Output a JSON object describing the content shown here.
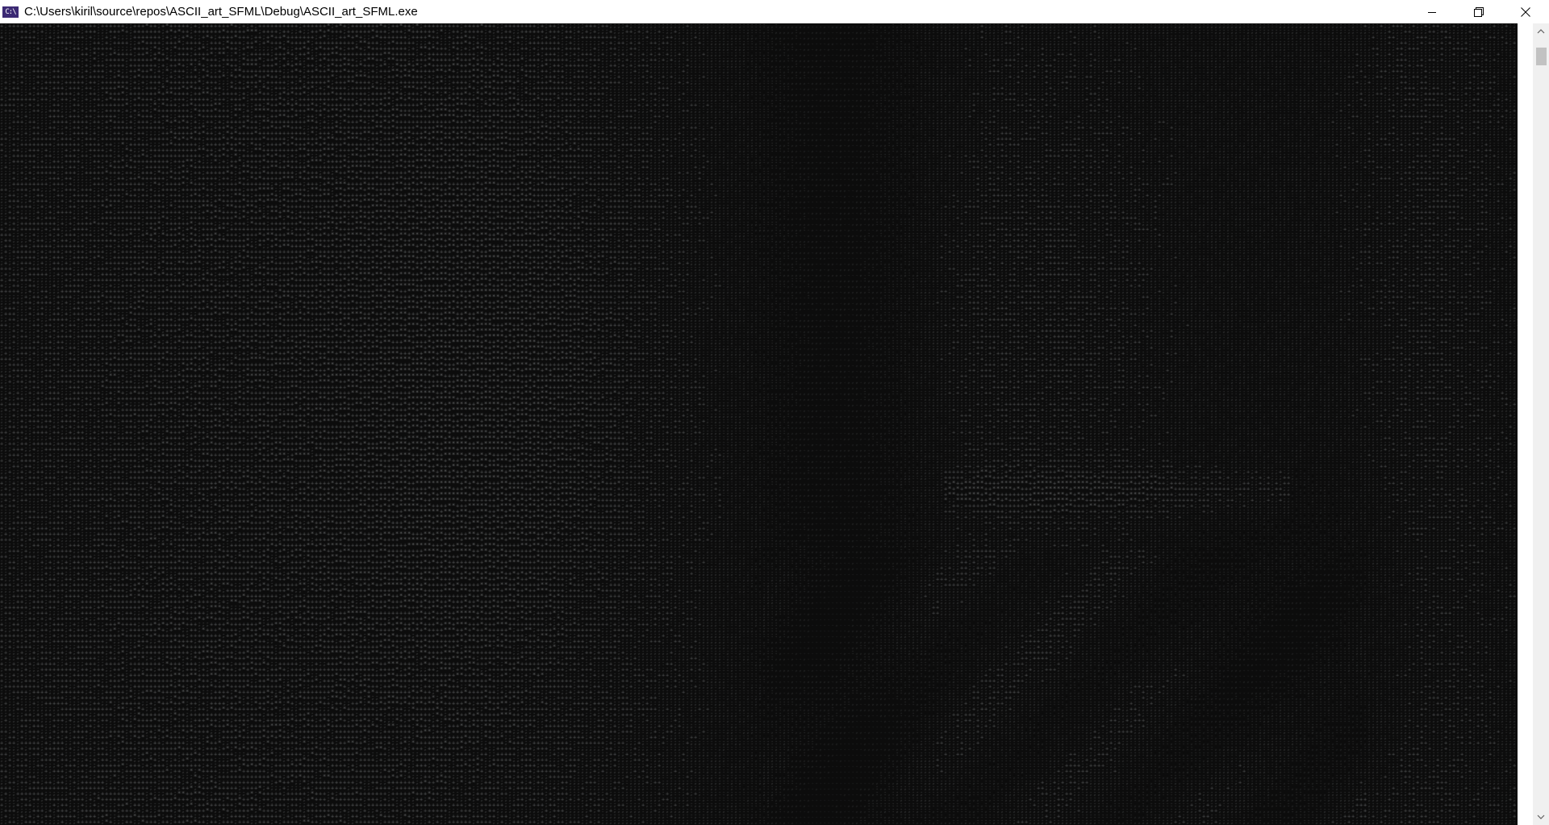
{
  "window": {
    "title": "C:\\Users\\kiril\\source\\repos\\ASCII_art_SFML\\Debug\\ASCII_art_SFML.exe",
    "icon": "console-app-icon",
    "icon_text": "C:\\",
    "controls": [
      "minimize-icon",
      "restore-icon",
      "close-icon"
    ]
  },
  "console": {
    "background": "#0c0c0c",
    "glyph_color": "#c8cbcc",
    "glyph_ramp": ".,:;+*?%S#@",
    "content": "ascii-art-render-of-dark-photo"
  },
  "scrollbar": {
    "up_icon": "chevron-up-icon",
    "down_icon": "chevron-down-icon",
    "position": 0
  }
}
